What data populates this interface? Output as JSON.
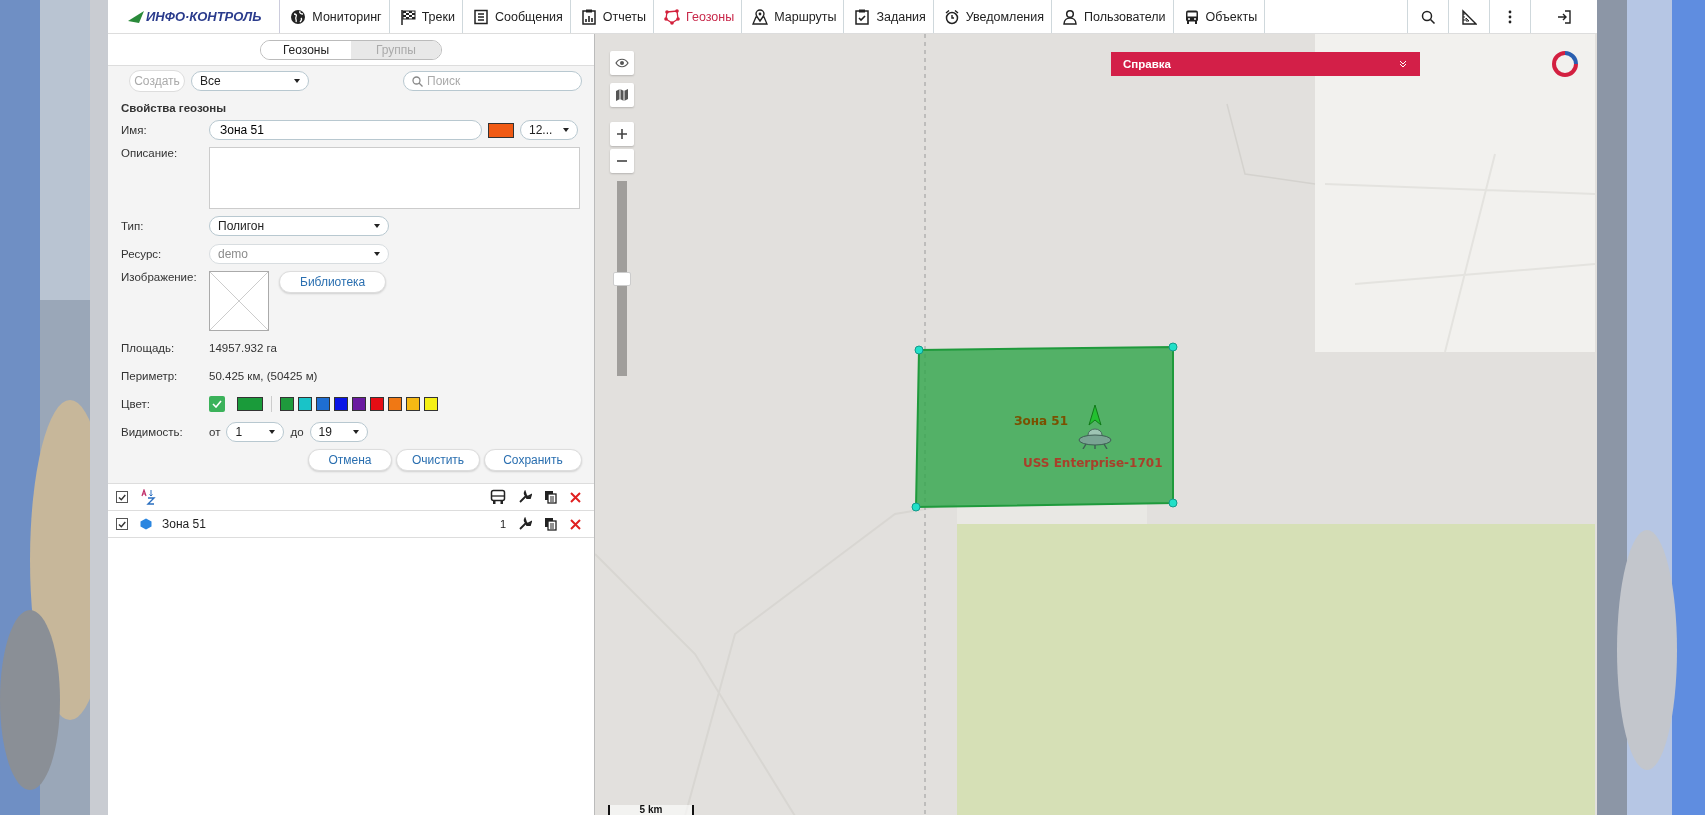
{
  "nav": {
    "logo": "ИНФО·КОНТРОЛЬ",
    "items": [
      {
        "label": "Мониторинг",
        "selected": false
      },
      {
        "label": "Треки",
        "selected": false
      },
      {
        "label": "Сообщения",
        "selected": false
      },
      {
        "label": "Отчеты",
        "selected": false
      },
      {
        "label": "Геозоны",
        "selected": true
      },
      {
        "label": "Маршруты",
        "selected": false
      },
      {
        "label": "Задания",
        "selected": false
      },
      {
        "label": "Уведомления",
        "selected": false
      },
      {
        "label": "Пользователи",
        "selected": false
      },
      {
        "label": "Объекты",
        "selected": false
      }
    ]
  },
  "panel": {
    "tabs": [
      {
        "label": "Геозоны",
        "selected": true
      },
      {
        "label": "Группы",
        "selected": false
      }
    ],
    "toolbar": {
      "create_button": {
        "label": "Создать",
        "disabled": true
      },
      "filter": {
        "value": "Все"
      },
      "search": {
        "placeholder": "Поиск"
      }
    },
    "form": {
      "title": "Свойства геозоны",
      "name": {
        "label": "Имя:",
        "value": "Зона 51",
        "color": "#f05a14",
        "font_size": "12..."
      },
      "description": {
        "label": "Описание:"
      },
      "type": {
        "label": "Тип:",
        "value": "Полигон"
      },
      "resource": {
        "label": "Ресурс:",
        "placeholder": "demo",
        "disabled": true
      },
      "image": {
        "label": "Изображение:",
        "button": "Библиотека"
      },
      "area": {
        "label": "Площадь:",
        "value": "14957.932 га"
      },
      "perimeter": {
        "label": "Периметр:",
        "value": "50.425 км, (50425 м)"
      },
      "color": {
        "label": "Цвет:",
        "checked": true,
        "current": {
          "color": "#1a9b3a"
        },
        "palette": [
          {
            "color": "#1e9a3c",
            "selected": false
          },
          {
            "color": "#19c3c8",
            "selected": false
          },
          {
            "color": "#1e6ed2",
            "selected": false
          },
          {
            "color": "#0a14e6",
            "selected": false
          },
          {
            "color": "#6a1aa0",
            "selected": false
          },
          {
            "color": "#e60d14",
            "selected": false
          },
          {
            "color": "#f07814",
            "selected": false
          },
          {
            "color": "#f5b914",
            "selected": false
          },
          {
            "color": "#f5f014",
            "selected": false
          }
        ]
      },
      "visibility": {
        "label": "Видимость:",
        "from_label": "от",
        "from": "1",
        "to_label": "до",
        "to": "19"
      },
      "buttons": [
        "Отмена",
        "Очистить",
        "Сохранить"
      ]
    },
    "list": {
      "header_checked": true,
      "rows": [
        {
          "name": "Зона 51",
          "count": "1",
          "checked": true
        }
      ]
    }
  },
  "map": {
    "help_bar": "Справка",
    "zoom_slider": {
      "level": 0.5
    },
    "scale": "5 km",
    "geozone": {
      "label": "Зона 51"
    },
    "unit": {
      "name": "USS Enterprise-1701"
    }
  }
}
